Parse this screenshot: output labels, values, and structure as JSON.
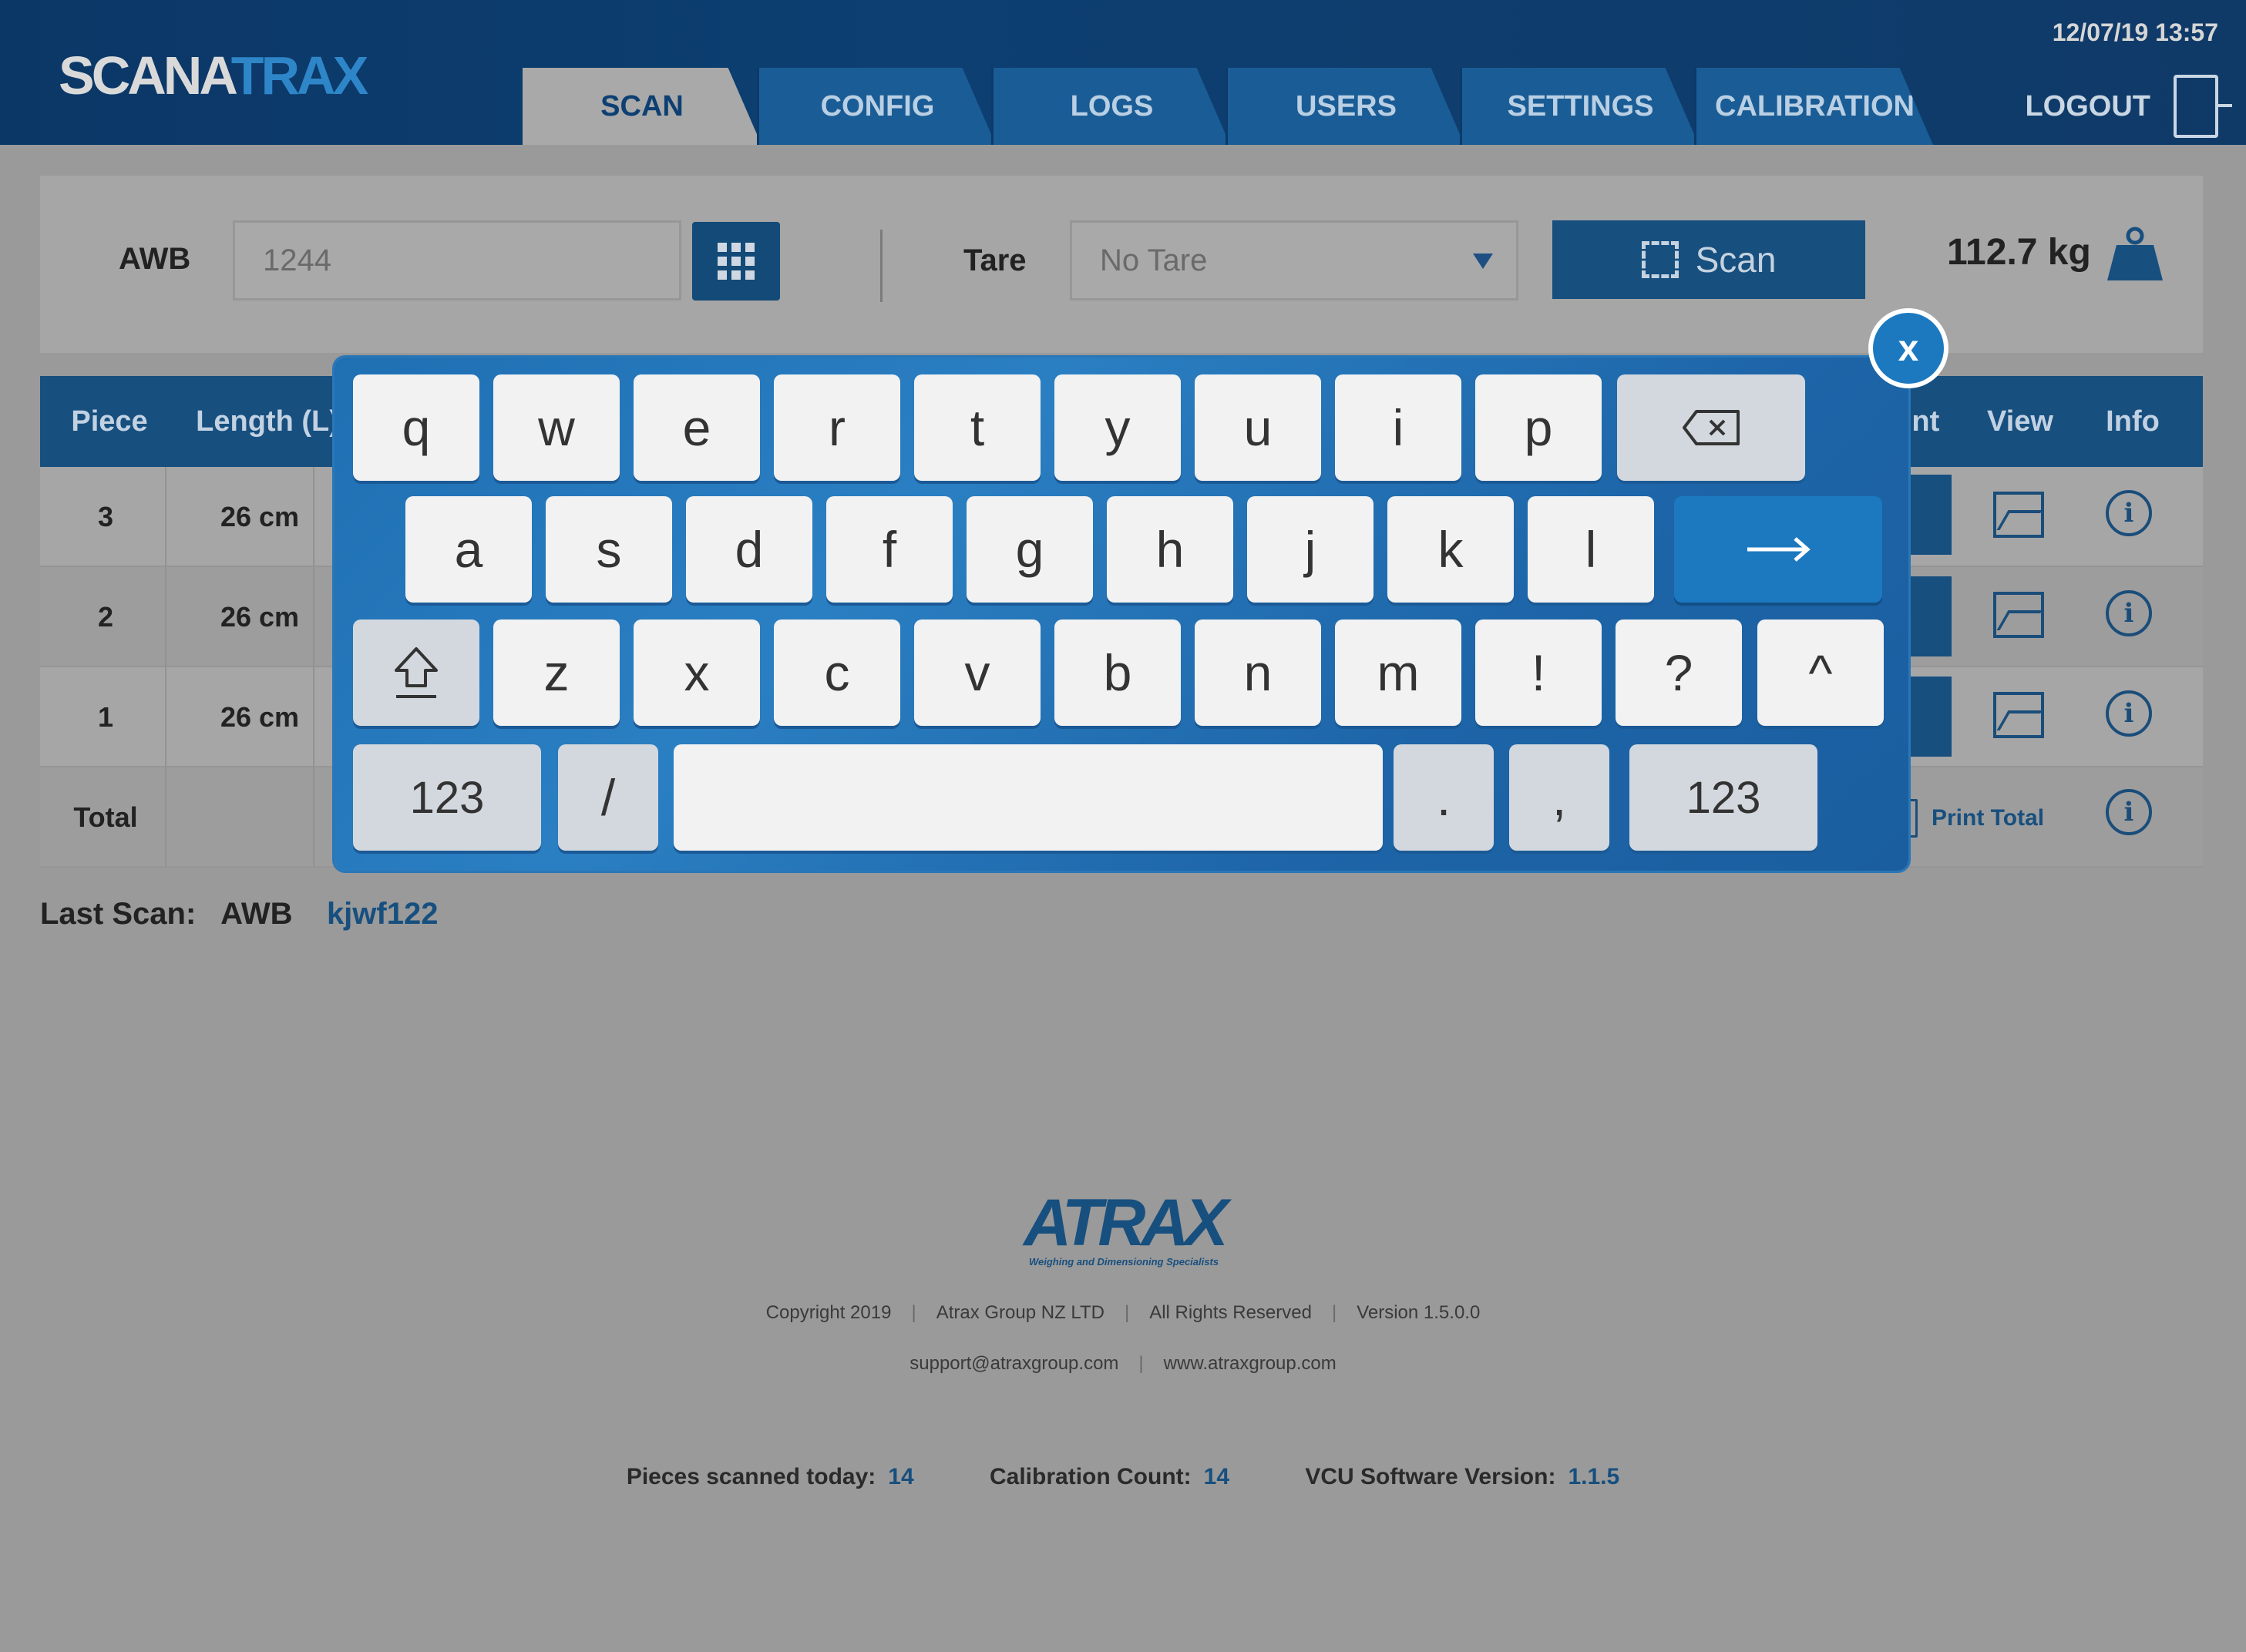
{
  "header": {
    "logo_part1": "SCANA",
    "logo_part2": "TRAX",
    "datetime": "12/07/19 13:57",
    "tabs": [
      "SCAN",
      "CONFIG",
      "LOGS",
      "USERS",
      "SETTINGS",
      "CALIBRATION"
    ],
    "active_tab": "SCAN",
    "logout": "LOGOUT"
  },
  "scanbar": {
    "awb_label": "AWB",
    "awb_value": "1244",
    "tare_label": "Tare",
    "tare_value": "No Tare",
    "scan_label": "Scan",
    "weight": "112.7 kg"
  },
  "table": {
    "headers": {
      "piece": "Piece",
      "length": "Length (L)",
      "print": "Print",
      "view": "View",
      "info": "Info"
    },
    "rows": [
      {
        "piece": "3",
        "length": "26 cm"
      },
      {
        "piece": "2",
        "length": "26 cm"
      },
      {
        "piece": "1",
        "length": "26 cm"
      }
    ],
    "total_label": "Total",
    "print_total": "Print Total"
  },
  "last_scan": {
    "label": "Last Scan:",
    "type": "AWB",
    "value": "kjwf122"
  },
  "footer": {
    "brand": "ATRAX",
    "tagline": "Weighing and Dimensioning Specialists",
    "copyright": "Copyright 2019",
    "company": "Atrax Group NZ LTD",
    "rights": "All Rights Reserved",
    "version": "Version 1.5.0.0",
    "email": "support@atraxgroup.com",
    "website": "www.atraxgroup.com"
  },
  "stats": {
    "pieces_label": "Pieces scanned today:",
    "pieces_value": "14",
    "calibration_label": "Calibration Count:",
    "calibration_value": "14",
    "vcu_label": "VCU Software Version:",
    "vcu_value": "1.1.5"
  },
  "keyboard": {
    "row1": [
      "q",
      "w",
      "e",
      "r",
      "t",
      "y",
      "u",
      "i",
      "p"
    ],
    "row2": [
      "a",
      "s",
      "d",
      "f",
      "g",
      "h",
      "j",
      "k",
      "l"
    ],
    "row3": [
      "z",
      "x",
      "c",
      "v",
      "b",
      "n",
      "m",
      "!",
      "?",
      "^"
    ],
    "num_left": "123",
    "slash": "/",
    "dot": ".",
    "comma": ",",
    "num_right": "123",
    "close": "x"
  },
  "colors": {
    "brand_blue": "#174f7f",
    "header_bg": "#0d3f72",
    "keyboard_blue": "#1f6fb3"
  }
}
